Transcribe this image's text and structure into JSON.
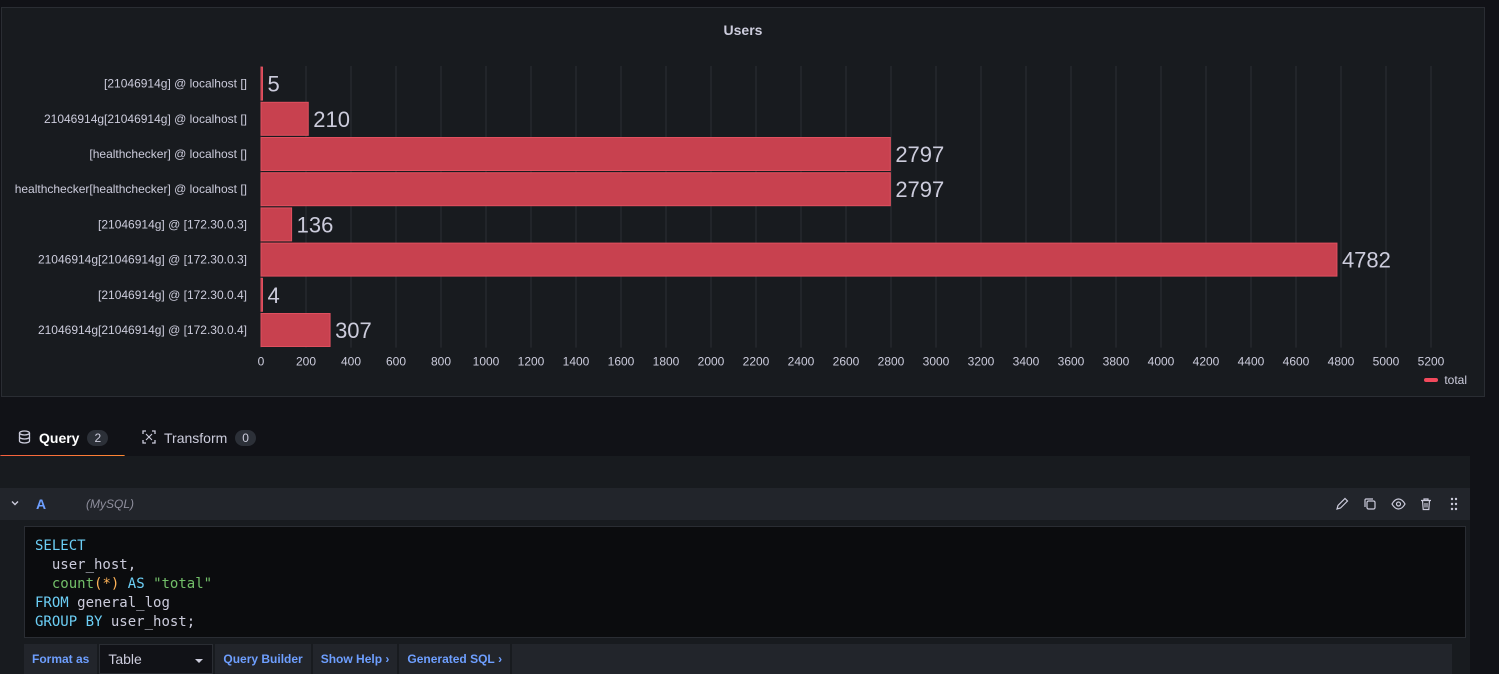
{
  "panel": {
    "title": "Users"
  },
  "chart_data": {
    "type": "bar",
    "orientation": "horizontal",
    "title": "Users",
    "categories": [
      "[21046914g] @ localhost []",
      "21046914g[21046914g] @ localhost []",
      "[healthchecker] @ localhost []",
      "healthchecker[healthchecker] @ localhost []",
      "[21046914g] @  [172.30.0.3]",
      "21046914g[21046914g] @  [172.30.0.3]",
      "[21046914g] @  [172.30.0.4]",
      "21046914g[21046914g] @  [172.30.0.4]"
    ],
    "series": [
      {
        "name": "total",
        "values": [
          5,
          210,
          2797,
          2797,
          136,
          4782,
          4,
          307
        ]
      }
    ],
    "xlim": [
      0,
      5200
    ],
    "xticks": [
      "0",
      "200",
      "400",
      "600",
      "800",
      "1000",
      "1200",
      "1400",
      "1600",
      "1800",
      "2000",
      "2200",
      "2400",
      "2600",
      "2800",
      "3000",
      "3200",
      "3400",
      "3600",
      "3800",
      "4000",
      "4200",
      "4400",
      "4600",
      "4800",
      "5000",
      "5200"
    ],
    "grid": true,
    "legend_placement": "bottom-right",
    "bar_color": "#c8414f"
  },
  "legend": {
    "label": "total",
    "color": "#f2495c"
  },
  "tabs": {
    "query": {
      "label": "Query",
      "count": "2"
    },
    "transform": {
      "label": "Transform",
      "count": "0"
    }
  },
  "query": {
    "ref_id": "A",
    "datasource": "(MySQL)",
    "sql": {
      "select": "SELECT",
      "col1": "user_host,",
      "count_fn": "count",
      "count_open": "(",
      "count_star": "*",
      "count_close": ")",
      "as": "AS",
      "alias": "\"total\"",
      "from": "FROM",
      "table": "general_log",
      "group_by": "GROUP BY",
      "group_col": "user_host;"
    },
    "toolbar": {
      "format_as": "Format as",
      "format_value": "Table",
      "query_builder": "Query Builder",
      "show_help": "Show Help",
      "generated_sql": "Generated SQL"
    }
  },
  "icons": {
    "query_tab": "database-icon",
    "transform_tab": "transform-icon",
    "edit": "pencil-icon",
    "duplicate": "copy-icon",
    "toggle": "eye-icon",
    "delete": "trash-icon",
    "drag": "drag-handle-icon"
  }
}
